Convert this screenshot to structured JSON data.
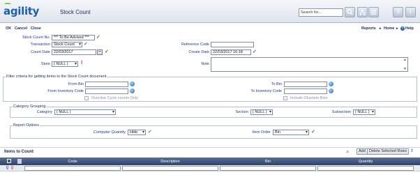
{
  "app": {
    "logo": "agility",
    "page_title": "Stock Count"
  },
  "search": {
    "placeholder": "Search for..."
  },
  "menu": {
    "ok": "OK",
    "cancel": "Cancel",
    "close": "Close",
    "reports": "Reports",
    "home": "Home",
    "help": "Help"
  },
  "form": {
    "stock_count_no_label": "Stock Count No.",
    "stock_count_no_value": "*** To Be Advised ***",
    "transaction_label": "Transaction",
    "transaction_value": "Stock Count",
    "count_date_label": "Count Date",
    "count_date_value": "22/03/2017",
    "store_label": "Store",
    "store_value": "( NULL )",
    "reference_code_label": "Reference Code",
    "reference_code_value": "",
    "create_date_label": "Create Date",
    "create_date_value": "22/03/2017 16:18",
    "note_label": "Note"
  },
  "filter": {
    "legend": "Filter criteria for getting items to the Stock Count document",
    "from_bin_label": "From Bin",
    "to_bin_label": "To Bin",
    "from_inventory_code_label": "From Inventory Code",
    "to_inventory_code_label": "To Inventory Code",
    "overdue_label": "Overdue Cycle counts Only",
    "obsolete_label": "Include Obsolete Bins"
  },
  "category": {
    "legend": "Category Grouping",
    "category_label": "Category",
    "category_value": "( NULL )",
    "section_label": "Section",
    "section_value": "( NULL )",
    "subsection_label": "Subsection",
    "subsection_value": "( NULL )"
  },
  "report": {
    "legend": "Report Options",
    "computer_quantity_label": "Computer Quantity",
    "computer_quantity_value": "Hide",
    "item_order_label": "Item Order",
    "item_order_value": "Bin"
  },
  "items": {
    "title": "Items to Count",
    "add_label": "Add",
    "delete_label": "Delete Selected Rows",
    "columns": [
      "Code",
      "Description",
      "Bin",
      "Quantity"
    ]
  },
  "colors": {
    "brand": "#1b5fae",
    "accent_green": "#7fc24a",
    "label_blue": "#1f3a8a",
    "grid_header": "#3c507a"
  }
}
